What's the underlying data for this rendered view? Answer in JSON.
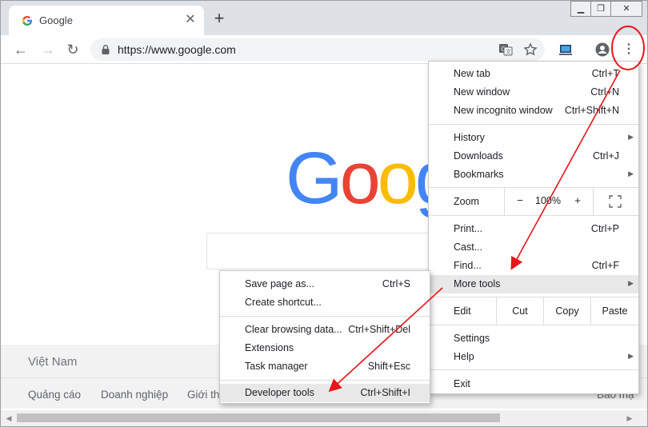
{
  "window": {
    "controls": {
      "minimize": "▁",
      "maximize": "❐",
      "close": "✕"
    }
  },
  "tab": {
    "title": "Google",
    "close_glyph": "✕"
  },
  "new_tab_glyph": "+",
  "toolbar": {
    "back_glyph": "←",
    "forward_glyph": "→",
    "reload_glyph": "↻",
    "url": "https://www.google.com",
    "menu_glyph": "⋮"
  },
  "page": {
    "logo_letters": [
      "G",
      "o",
      "o",
      "g"
    ],
    "logo_colors": [
      "#4285f4",
      "#ea4335",
      "#fbbc05",
      "#4285f4"
    ],
    "footer_country": "Việt Nam",
    "footer_links": [
      "Quảng cáo",
      "Doanh nghiệp",
      "Giới thi",
      "Bảo mậ"
    ]
  },
  "main_menu": {
    "new_tab": {
      "label": "New tab",
      "shortcut": "Ctrl+T"
    },
    "new_window": {
      "label": "New window",
      "shortcut": "Ctrl+N"
    },
    "new_incognito": {
      "label": "New incognito window",
      "shortcut": "Ctrl+Shift+N"
    },
    "history": {
      "label": "History"
    },
    "downloads": {
      "label": "Downloads",
      "shortcut": "Ctrl+J"
    },
    "bookmarks": {
      "label": "Bookmarks"
    },
    "zoom": {
      "label": "Zoom",
      "minus": "−",
      "value": "100%",
      "plus": "+"
    },
    "print": {
      "label": "Print...",
      "shortcut": "Ctrl+P"
    },
    "cast": {
      "label": "Cast..."
    },
    "find": {
      "label": "Find...",
      "shortcut": "Ctrl+F"
    },
    "more_tools": {
      "label": "More tools"
    },
    "edit": {
      "label": "Edit",
      "cut": "Cut",
      "copy": "Copy",
      "paste": "Paste"
    },
    "settings": {
      "label": "Settings"
    },
    "help": {
      "label": "Help"
    },
    "exit": {
      "label": "Exit"
    },
    "arrow_glyph": "▶"
  },
  "sub_menu": {
    "save_page": {
      "label": "Save page as...",
      "shortcut": "Ctrl+S"
    },
    "create_shortcut": {
      "label": "Create shortcut..."
    },
    "clear_data": {
      "label": "Clear browsing data...",
      "shortcut": "Ctrl+Shift+Del"
    },
    "extensions": {
      "label": "Extensions"
    },
    "task_manager": {
      "label": "Task manager",
      "shortcut": "Shift+Esc"
    },
    "developer_tools": {
      "label": "Developer tools",
      "shortcut": "Ctrl+Shift+I"
    }
  },
  "colors": {
    "annotation_red": "#e8141a",
    "menu_highlight": "#e8e8e8"
  }
}
